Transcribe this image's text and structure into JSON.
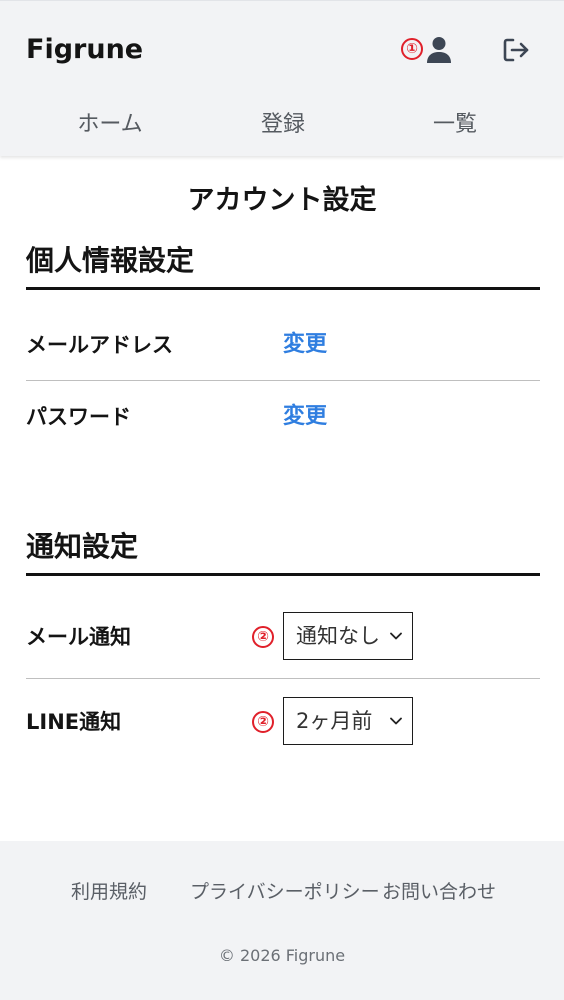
{
  "header": {
    "brand": "Figrune",
    "account_marker": "①",
    "icons": {
      "account": "user-icon",
      "logout": "logout-icon"
    }
  },
  "nav": {
    "items": [
      {
        "label": "ホーム"
      },
      {
        "label": "登録"
      },
      {
        "label": "一覧"
      }
    ]
  },
  "page": {
    "title": "アカウント設定"
  },
  "personal": {
    "title": "個人情報設定",
    "rows": [
      {
        "label": "メールアドレス",
        "action": "変更"
      },
      {
        "label": "パスワード",
        "action": "変更"
      }
    ]
  },
  "notification": {
    "title": "通知設定",
    "rows": [
      {
        "label": "メール通知",
        "marker": "②",
        "value": "通知なし"
      },
      {
        "label": "LINE通知",
        "marker": "②",
        "value": "2ヶ月前"
      }
    ]
  },
  "footer": {
    "links": [
      {
        "label": "利用規約"
      },
      {
        "label": "プライバシーポリシー"
      },
      {
        "label": "お問い合わせ"
      }
    ],
    "copyright": "© 2026 Figrune"
  },
  "colors": {
    "accent_link": "#2f7ee0",
    "marker_red": "#e0202a",
    "header_bg": "#f2f3f5",
    "icon_slate": "#3d4654"
  }
}
